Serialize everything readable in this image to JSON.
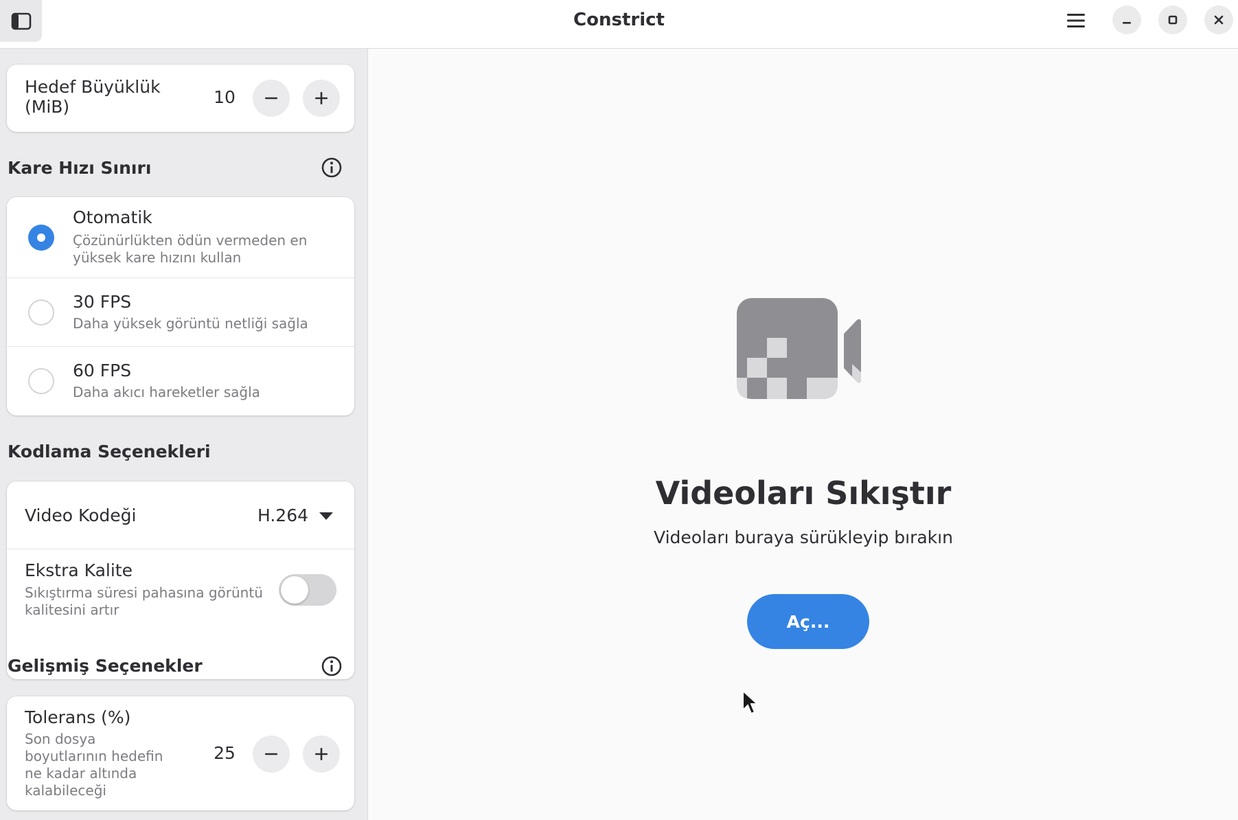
{
  "window": {
    "title": "Constrict"
  },
  "icons": {
    "sidebar_toggle": "sidebar-toggle-icon",
    "menu": "hamburger-menu-icon",
    "minimize": "minimize-icon",
    "maximize": "maximize-icon",
    "close": "close-icon",
    "info": "info-icon",
    "video": "video-camera-icon"
  },
  "colors": {
    "accent": "#3584e4",
    "sidebar_bg": "#ebebed",
    "card_bg": "#ffffff",
    "main_bg": "#fafafa",
    "muted_text": "#7c7c82"
  },
  "sidebar": {
    "target_size": {
      "label": "Hedef Büyüklük (MiB)",
      "value": "10",
      "decrement": "−",
      "increment": "+"
    },
    "frame_rate": {
      "heading": "Kare Hızı Sınırı",
      "selected": "auto",
      "options": [
        {
          "title": "Otomatik",
          "subtitle": "Çözünürlükten ödün vermeden en yüksek kare hızını kullan",
          "checked": true
        },
        {
          "title": "30 FPS",
          "subtitle": "Daha yüksek görüntü netliği sağla",
          "checked": false
        },
        {
          "title": "60 FPS",
          "subtitle": "Daha akıcı hareketler sağla",
          "checked": false
        }
      ]
    },
    "encoding": {
      "heading": "Kodlama Seçenekleri",
      "codec_label": "Video Kodeği",
      "codec_value": "H.264",
      "extra_quality_title": "Ekstra Kalite",
      "extra_quality_subtitle": "Sıkıştırma süresi pahasına görüntü kalitesini artır",
      "extra_quality_enabled": false
    },
    "advanced": {
      "heading": "Gelişmiş Seçenekler",
      "tolerance_title": "Tolerans (%)",
      "tolerance_subtitle": "Son dosya boyutlarının hedefin ne kadar altında kalabileceği",
      "tolerance_value": "25",
      "decrement": "−",
      "increment": "+"
    }
  },
  "main": {
    "title": "Videoları Sıkıştır",
    "subtitle": "Videoları buraya sürükleyip bırakın",
    "open_button": "Aç..."
  }
}
